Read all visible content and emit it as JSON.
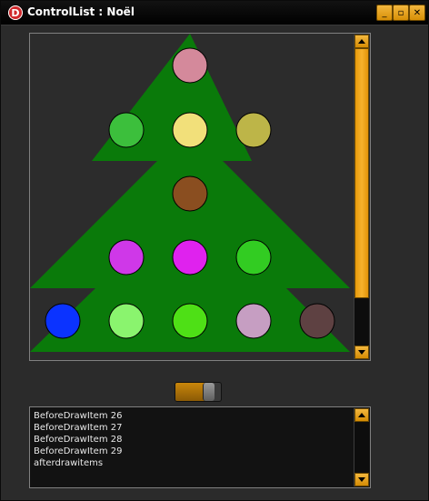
{
  "window": {
    "title": "ControlList : Noël",
    "logo_letter": "D",
    "buttons": {
      "minimize": "_",
      "maximize": "▫",
      "close": "✕"
    }
  },
  "tree": {
    "background": "#2c2c2c",
    "tree_color": "#0a7a0a",
    "ball_colors": [
      "#d4899b",
      "#3cbf3c",
      "#f2e07a",
      "#bdb548",
      "#8a4e20",
      "#cf38e8",
      "#df22ee",
      "#32cc22",
      "#0b33ff",
      "#8af46e",
      "#4ee016",
      "#c69ec2",
      "#5e4142"
    ]
  },
  "tree_scrollbar": {
    "accent": "#f0a820",
    "position_pct": 0
  },
  "slider": {
    "value_pct": 78
  },
  "log": {
    "lines": [
      "BeforeDrawItem 26",
      "BeforeDrawItem 27",
      "BeforeDrawItem 28",
      "BeforeDrawItem 29",
      "afterdrawitems"
    ]
  }
}
